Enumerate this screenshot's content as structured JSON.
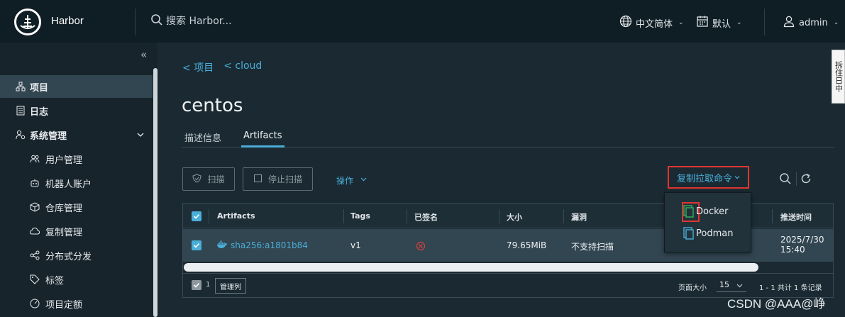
{
  "header": {
    "brand": "Harbor",
    "search_placeholder": "搜索 Harbor...",
    "language": "中文简体",
    "theme": "默认",
    "user": "admin"
  },
  "sidebar": {
    "items": [
      {
        "label": "项目",
        "icon": "project-icon"
      },
      {
        "label": "日志",
        "icon": "log-icon"
      },
      {
        "label": "系统管理",
        "icon": "admin-icon"
      },
      {
        "label": "用户管理",
        "icon": "users-icon"
      },
      {
        "label": "机器人账户",
        "icon": "robot-icon"
      },
      {
        "label": "仓库管理",
        "icon": "registry-icon"
      },
      {
        "label": "复制管理",
        "icon": "replication-icon"
      },
      {
        "label": "分布式分发",
        "icon": "distribution-icon"
      },
      {
        "label": "标签",
        "icon": "tag-icon"
      },
      {
        "label": "项目定额",
        "icon": "quota-icon"
      }
    ]
  },
  "breadcrumb": {
    "items": [
      "< 项目",
      "< cloud"
    ]
  },
  "page": {
    "title": "centos"
  },
  "tabs": [
    {
      "label": "描述信息"
    },
    {
      "label": "Artifacts"
    }
  ],
  "toolbar": {
    "scan": "扫描",
    "stop_scan": "停止扫描",
    "actions": "操作",
    "copy_pull": "复制拉取命令"
  },
  "table": {
    "columns": [
      "Artifacts",
      "Tags",
      "已签名",
      "大小",
      "漏洞",
      "推送时间"
    ],
    "rows": [
      {
        "artifact": "sha256:a1801b84",
        "tags": "v1",
        "size": "79.65MiB",
        "vulnerability": "不支持扫描",
        "push_date": "2025/7/30",
        "push_time": "15:40"
      }
    ],
    "selected_count": "1",
    "manage_columns": "管理列",
    "page_size_label": "页面大小",
    "page_size": "15",
    "summary": "1 - 1 共计 1 条记录"
  },
  "pull_menu": {
    "items": [
      "Docker",
      "Podman"
    ]
  },
  "side_tab": "拆住日中",
  "watermark": "CSDN @AAA@峥",
  "colors": {
    "accent": "#4aaed9",
    "highlight": "#e0362f",
    "docker_green": "#2fb35c"
  }
}
